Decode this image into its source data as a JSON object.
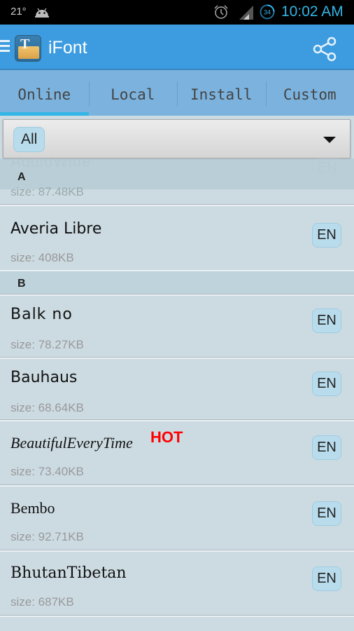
{
  "status_bar": {
    "temperature": "21°",
    "time": "10:02 AM",
    "battery_level": "34",
    "icons": [
      "android-debug-icon",
      "alarm-icon",
      "signal-icon",
      "battery-icon"
    ]
  },
  "action_bar": {
    "title": "iFont",
    "icons": [
      "drawer-menu-icon",
      "app-logo-icon",
      "share-icon"
    ]
  },
  "tabs": [
    {
      "label": "Online",
      "active": true
    },
    {
      "label": "Local",
      "active": false
    },
    {
      "label": "Install",
      "active": false
    },
    {
      "label": "Custom",
      "active": false
    }
  ],
  "filter": {
    "selected": "All"
  },
  "list": {
    "partial_top": {
      "name": "AudioWide",
      "section": "A",
      "size": "size: 87.48KB",
      "lang": "EN"
    },
    "items": [
      {
        "type": "font",
        "name": "Averia Libre",
        "size": "size: 408KB",
        "lang": "EN"
      },
      {
        "type": "section",
        "label": "B"
      },
      {
        "type": "font",
        "name": "Balk no",
        "size": "size: 78.27KB",
        "lang": "EN"
      },
      {
        "type": "font",
        "name": "Bauhaus",
        "size": "size: 68.64KB",
        "lang": "EN"
      },
      {
        "type": "font",
        "name": "BeautifulEveryTime",
        "badge": "HOT",
        "size": "size: 73.40KB",
        "lang": "EN"
      },
      {
        "type": "font",
        "name": "Bembo",
        "size": "size: 92.71KB",
        "lang": "EN"
      },
      {
        "type": "font",
        "name": "BhutanTibetan",
        "size": "size: 687KB",
        "lang": "EN"
      }
    ]
  },
  "colors": {
    "action_bar": "#3d9ce0",
    "tabs_bg": "#7cb3de",
    "tab_indicator": "#33b5e5",
    "list_bg": "#ccdbe2",
    "badge_bg": "#b9dcec",
    "hot": "#ff0000",
    "clock": "#33b5e5"
  }
}
